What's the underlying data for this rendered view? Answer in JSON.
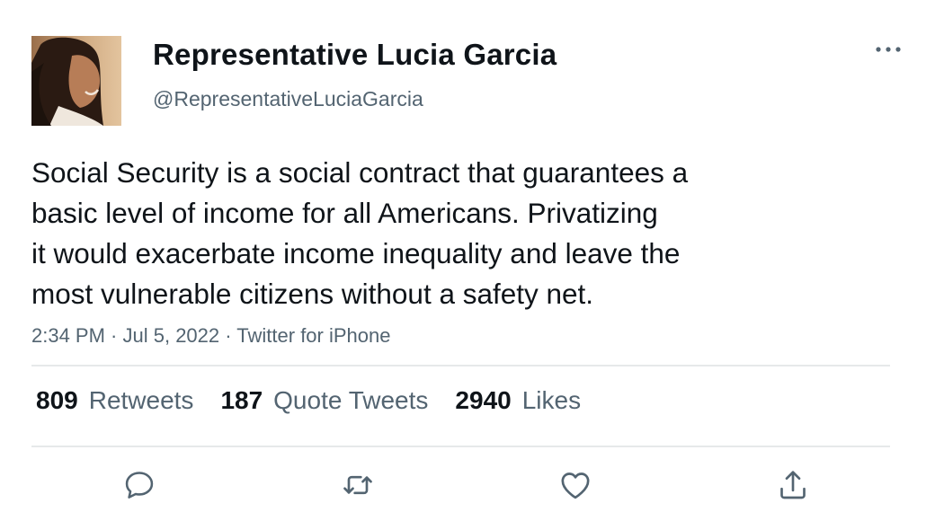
{
  "author": {
    "display_name": "Representative Lucia Garcia",
    "handle": "@RepresentativeLuciaGarcia",
    "avatar_icon": "profile-photo"
  },
  "tweet": {
    "text_lines": [
      "Social Security is a social contract that guarantees a",
      "basic level of income for all Americans. Privatizing",
      "it would exacerbate income inequality and leave the",
      "most vulnerable citizens without a safety net."
    ],
    "time": "2:34 PM",
    "date": "Jul 5, 2022",
    "source": "Twitter for iPhone",
    "separator": " · "
  },
  "stats": {
    "retweets": {
      "count": "809",
      "label": "Retweets"
    },
    "quote_tweets": {
      "count": "187",
      "label": "Quote Tweets"
    },
    "likes": {
      "count": "2940",
      "label": "Likes"
    }
  },
  "actions": {
    "reply_icon": "comment-icon",
    "retweet_icon": "retweet-icon",
    "like_icon": "heart-icon",
    "share_icon": "share-icon"
  },
  "colors": {
    "text_primary": "#0f1419",
    "text_secondary": "#536471",
    "divider": "#e6e9ea",
    "icon": "#536471"
  }
}
